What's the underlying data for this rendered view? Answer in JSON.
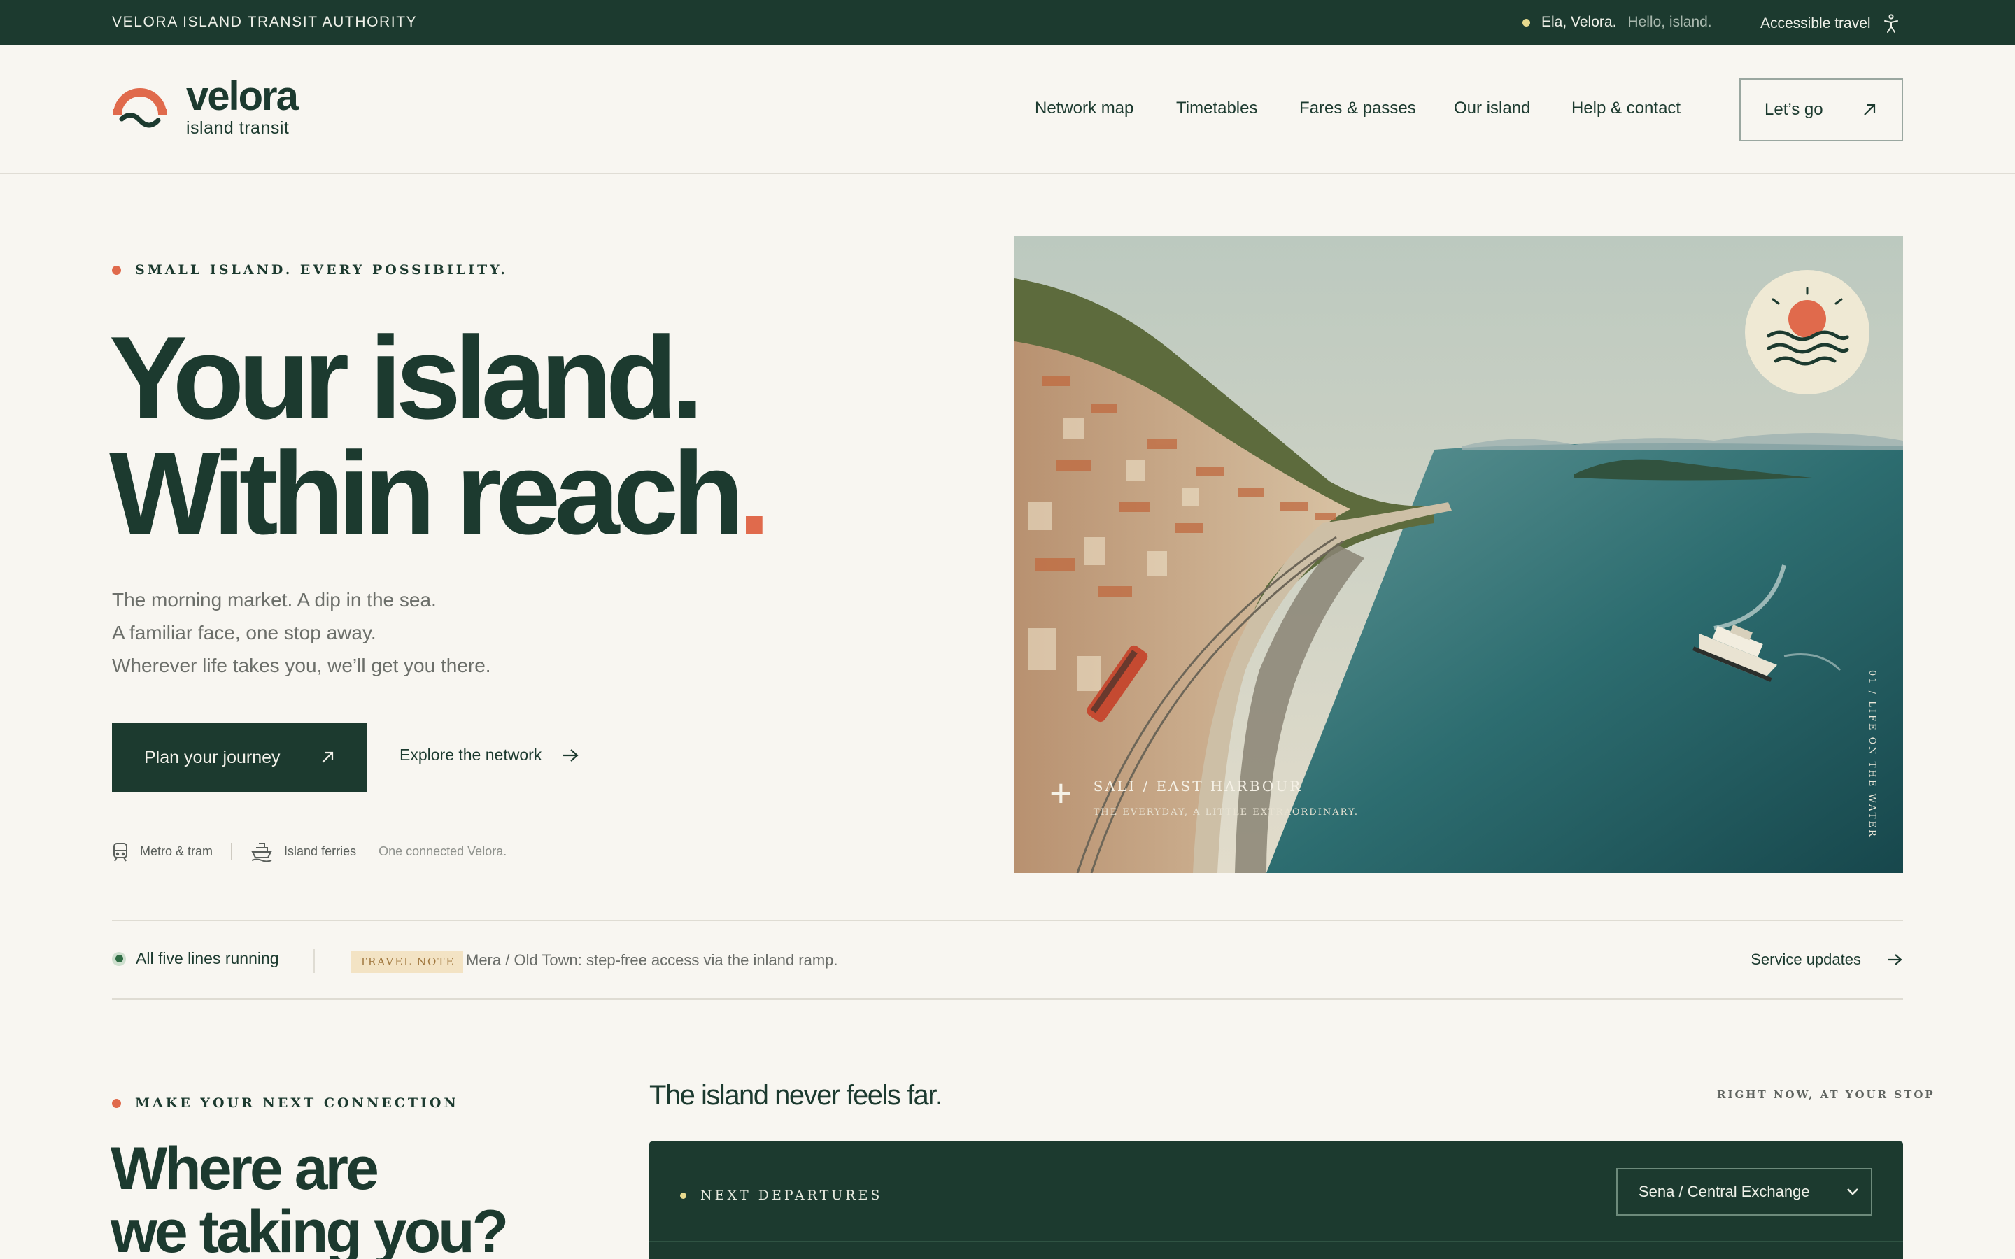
{
  "topbar": {
    "authority": "VELORA ISLAND TRANSIT AUTHORITY",
    "greeting": "Ela, Velora.",
    "greeting_sub": "Hello, island.",
    "accessible": "Accessible travel"
  },
  "brand": {
    "name": "velora",
    "tagline": "island transit"
  },
  "nav": {
    "items": [
      "Network map",
      "Timetables",
      "Fares & passes",
      "Our island",
      "Help & contact"
    ],
    "cta": "Let’s go"
  },
  "hero": {
    "eyebrow": "SMALL ISLAND. EVERY POSSIBILITY.",
    "title_line1": "Your island.",
    "title_line2": "Within reach",
    "title_accent": ".",
    "copy": [
      "The morning market. A dip in the sea.",
      "A familiar face, one stop away.",
      "Wherever life takes you, we’ll get you there."
    ],
    "primary_cta": "Plan your journey",
    "secondary_cta": "Explore the network",
    "modes": [
      "Metro & tram",
      "Island ferries"
    ],
    "modes_note": "One connected Velora."
  },
  "image": {
    "place": "SALI / EAST HARBOUR",
    "caption": "THE EVERYDAY, A LITTLE EXTRAORDINARY.",
    "side_label": "01 / LIFE ON THE WATER"
  },
  "status": {
    "running": "All five lines running",
    "note_tag": "TRAVEL NOTE",
    "note_text": "Mera / Old Town: step-free access via the inland ramp.",
    "updates": "Service updates"
  },
  "connection": {
    "eyebrow": "MAKE YOUR NEXT CONNECTION",
    "title_line1": "Where are",
    "title_line2": "we taking you?",
    "subtitle": "The island never feels far.",
    "right_label": "RIGHT NOW, AT YOUR STOP",
    "departures_label": "NEXT DEPARTURES",
    "selected_stop": "Sena / Central Exchange"
  },
  "colors": {
    "forest": "#1c3a2f",
    "coral": "#e06a4c",
    "cream": "#f8f6f1",
    "sun_yellow": "#e6d98e"
  }
}
